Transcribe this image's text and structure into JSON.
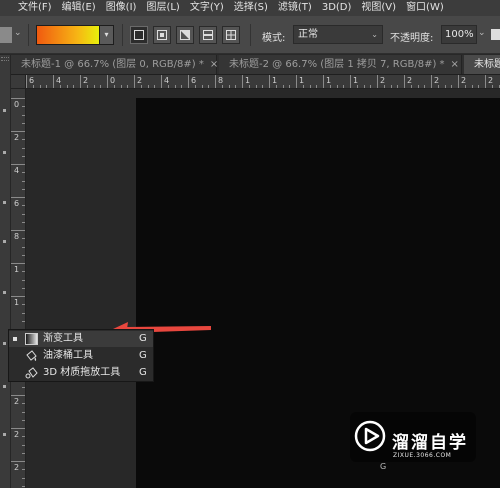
{
  "menubar": {
    "items": [
      {
        "label": "文件(F)"
      },
      {
        "label": "编辑(E)"
      },
      {
        "label": "图像(I)"
      },
      {
        "label": "图层(L)"
      },
      {
        "label": "文字(Y)"
      },
      {
        "label": "选择(S)"
      },
      {
        "label": "滤镜(T)"
      },
      {
        "label": "3D(D)"
      },
      {
        "label": "视图(V)"
      },
      {
        "label": "窗口(W)"
      }
    ]
  },
  "options": {
    "gradient_colors": [
      "#f05a10",
      "#f7b514",
      "#e7f00c"
    ],
    "gradient_types": [
      "linear-gradient-icon",
      "radial-gradient-icon",
      "angle-gradient-icon",
      "reflected-gradient-icon",
      "diamond-gradient-icon"
    ],
    "mode_label": "模式:",
    "mode_value": "正常",
    "opacity_label": "不透明度:",
    "opacity_value": "100%"
  },
  "tabs": [
    {
      "label": "未标题-1 @ 66.7% (图层 0, RGB/8#) *",
      "close": "×",
      "active": false
    },
    {
      "label": "未标题-2 @ 66.7% (图层 1 拷贝 7, RGB/8#) *",
      "close": "×",
      "active": false
    },
    {
      "label": "未标题",
      "close": "",
      "active": true
    }
  ],
  "hruler": {
    "labels": [
      "6",
      "4",
      "2",
      "0",
      "2",
      "4",
      "6",
      "8",
      "1",
      "1",
      "1",
      "1",
      "1",
      "2",
      "2",
      "2",
      "2",
      "2"
    ]
  },
  "vruler": {
    "labels": [
      "0",
      "2",
      "4",
      "6",
      "8",
      "1",
      "1",
      "1",
      "1",
      "2",
      "2",
      "2",
      "2"
    ]
  },
  "flyout": {
    "items": [
      {
        "icon": "gradient-tool-icon",
        "label": "渐变工具",
        "shortcut": "G",
        "selected": true
      },
      {
        "icon": "paint-bucket-icon",
        "label": "油漆桶工具",
        "shortcut": "G",
        "selected": false
      },
      {
        "icon": "3d-material-drop-icon",
        "label": "3D 材质拖放工具",
        "shortcut": "G",
        "selected": false
      }
    ]
  },
  "annotation": {
    "color": "#e8473e"
  },
  "watermark": {
    "brand": "溜溜自学",
    "url": "ZIXUE.3066.COM",
    "trailing": "G"
  }
}
